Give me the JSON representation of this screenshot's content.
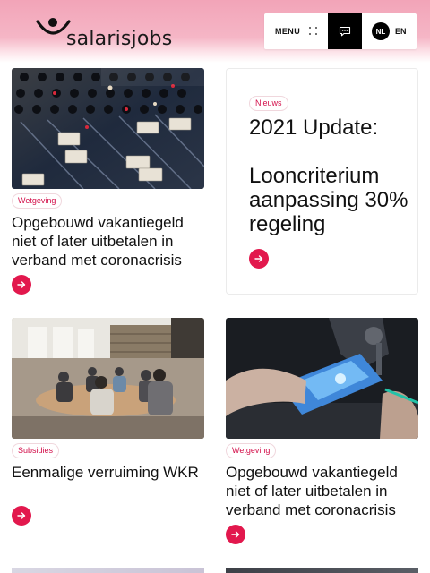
{
  "brand": {
    "name": "salarisjobs",
    "accent": "#e2184d",
    "header_color": "#f2a4b8"
  },
  "topbar": {
    "menu_label": "MENU",
    "menu_icon": "grid-dots-icon",
    "chat_icon": "chat-bubble-icon",
    "lang_active": "NL",
    "lang_other": "EN"
  },
  "cards": [
    {
      "tag": "Wetgeving",
      "title": "Opgebouwd vakantiegeld niet of later uitbetalen in verband met coronacrisis",
      "image": "mixing-console-photo"
    },
    {
      "tag": "Nieuws",
      "title": "2021 Update:\n\nLooncriterium aanpassing 30% regeling"
    },
    {
      "tag": "Subsidies",
      "title": "Eenmalige verruiming WKR",
      "image": "office-meeting-photo"
    },
    {
      "tag": "Wetgeving",
      "title": "Opgebouwd vakantiegeld niet of later uitbetalen in verband met coronacrisis",
      "image": "microscope-lab-photo"
    }
  ]
}
